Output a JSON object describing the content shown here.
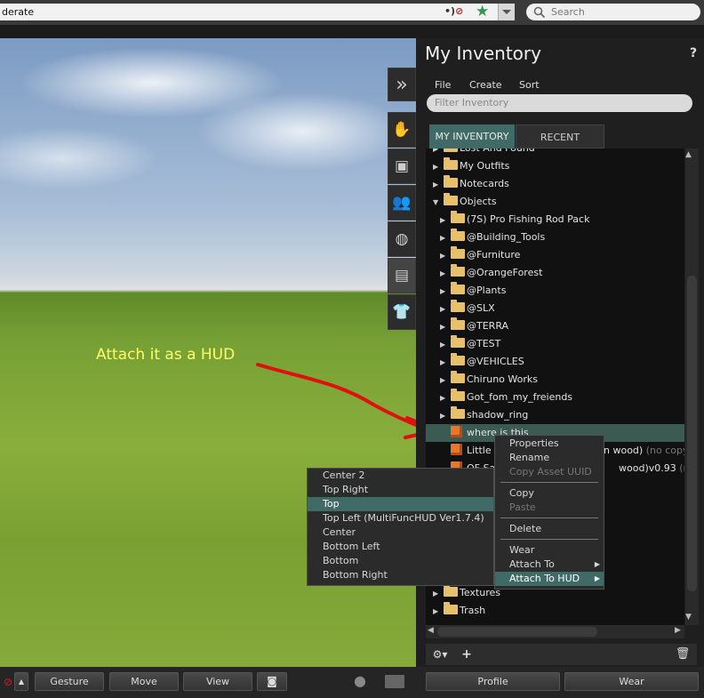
{
  "top_bar": {
    "region_text": "derate",
    "search_placeholder": "Search"
  },
  "world": {
    "annotation": "Attach it as a HUD"
  },
  "inventory": {
    "title": "My Inventory",
    "help": "?",
    "menu": [
      "File",
      "Create",
      "Sort"
    ],
    "filter_placeholder": "Filter Inventory",
    "tabs": {
      "my_inventory": "MY INVENTORY",
      "recent": "RECENT"
    },
    "tree": [
      {
        "label": "Lost And Found",
        "type": "folder",
        "level": 0
      },
      {
        "label": "My Outfits",
        "type": "folder",
        "level": 0
      },
      {
        "label": "Notecards",
        "type": "folder",
        "level": 0
      },
      {
        "label": "Objects",
        "type": "folder-open",
        "level": 0
      },
      {
        "label": "(7S) Pro Fishing Rod Pack",
        "type": "folder",
        "level": 1
      },
      {
        "label": "@Building_Tools",
        "type": "folder",
        "level": 1
      },
      {
        "label": "@Furniture",
        "type": "folder",
        "level": 1
      },
      {
        "label": "@OrangeForest",
        "type": "folder",
        "level": 1
      },
      {
        "label": "@Plants",
        "type": "folder",
        "level": 1
      },
      {
        "label": "@SLX",
        "type": "folder",
        "level": 1
      },
      {
        "label": "@TERRA",
        "type": "folder",
        "level": 1
      },
      {
        "label": "@TEST",
        "type": "folder",
        "level": 1
      },
      {
        "label": "@VEHICLES",
        "type": "folder",
        "level": 1
      },
      {
        "label": "Chiruno Works",
        "type": "folder",
        "level": 1
      },
      {
        "label": "Got_fom_my_freiends",
        "type": "folder",
        "level": 1
      },
      {
        "label": "shadow_ring",
        "type": "folder",
        "level": 1
      },
      {
        "label": "where is this",
        "type": "object",
        "level": 1,
        "selected": true
      },
      {
        "label": "Little",
        "type": "object",
        "level": 1,
        "suffix": "n wood)",
        "dim": "(no copy"
      },
      {
        "label": "QF Sa",
        "type": "object",
        "level": 1,
        "suffix": "wood)v0.93",
        "dim": "(no c"
      },
      {
        "label": "Textures",
        "type": "folder",
        "level": 0
      },
      {
        "label": "Trash",
        "type": "folder",
        "level": 0
      }
    ],
    "bottom_controls": {
      "gear": "⚙▾",
      "add": "+",
      "trash": "🗑"
    }
  },
  "context_menu": {
    "items": [
      {
        "label": "Properties",
        "enabled": true
      },
      {
        "label": "Rename",
        "enabled": true
      },
      {
        "label": "Copy Asset UUID",
        "enabled": false
      },
      {
        "sep": true
      },
      {
        "label": "Copy",
        "enabled": true
      },
      {
        "label": "Paste",
        "enabled": false
      },
      {
        "sep": true
      },
      {
        "label": "Delete",
        "enabled": true
      },
      {
        "sep": true
      },
      {
        "label": "Wear",
        "enabled": true
      },
      {
        "label": "Attach To",
        "enabled": true,
        "submenu": true
      },
      {
        "label": "Attach To HUD",
        "enabled": true,
        "submenu": true,
        "highlight": true
      }
    ]
  },
  "hud_submenu": {
    "items": [
      {
        "label": "Center 2"
      },
      {
        "label": "Top Right"
      },
      {
        "label": "Top",
        "highlight": true
      },
      {
        "label": "Top Left (MultiFuncHUD Ver1.7.4)"
      },
      {
        "label": "Center"
      },
      {
        "label": "Bottom Left"
      },
      {
        "label": "Bottom"
      },
      {
        "label": "Bottom Right"
      }
    ]
  },
  "bottom_bar": {
    "gesture": "Gesture",
    "move": "Move",
    "view": "View",
    "profile": "Profile",
    "wear": "Wear"
  },
  "colors": {
    "accent": "#3f6a66",
    "annotation": "#ffff66",
    "arrow": "#e01010"
  }
}
